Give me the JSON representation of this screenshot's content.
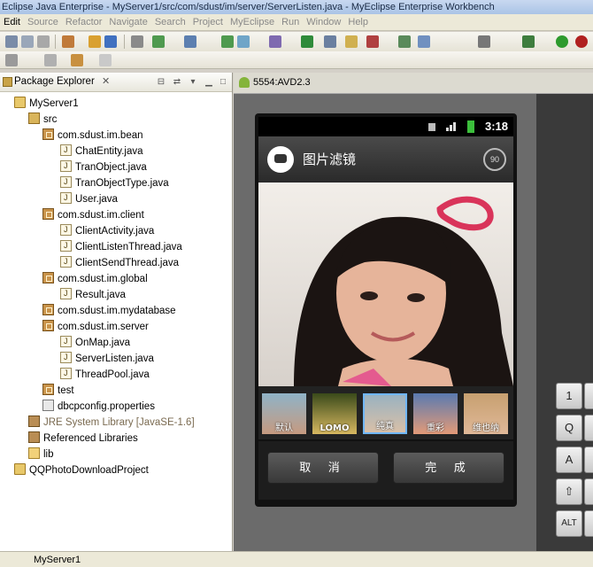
{
  "window": {
    "title": "Eclipse Java Enterprise - MyServer1/src/com/sdust/im/server/ServerListen.java - MyEclipse Enterprise Workbench"
  },
  "menu": [
    "Edit",
    "Source",
    "Refactor",
    "Navigate",
    "Search",
    "Project",
    "MyEclipse",
    "Run",
    "Window",
    "Help"
  ],
  "explorer": {
    "title": "Package Explorer",
    "tree": [
      {
        "label": "MyServer1",
        "icon": "project-icon",
        "indent": 0
      },
      {
        "label": "src",
        "icon": "source-folder-icon",
        "indent": 1
      },
      {
        "label": "com.sdust.im.bean",
        "icon": "package-icon",
        "indent": 2
      },
      {
        "label": "ChatEntity.java",
        "icon": "java-file-icon",
        "indent": 3
      },
      {
        "label": "TranObject.java",
        "icon": "java-file-icon",
        "indent": 3
      },
      {
        "label": "TranObjectType.java",
        "icon": "java-file-icon",
        "indent": 3
      },
      {
        "label": "User.java",
        "icon": "java-file-icon",
        "indent": 3
      },
      {
        "label": "com.sdust.im.client",
        "icon": "package-icon",
        "indent": 2
      },
      {
        "label": "ClientActivity.java",
        "icon": "java-file-icon",
        "indent": 3
      },
      {
        "label": "ClientListenThread.java",
        "icon": "java-file-icon",
        "indent": 3
      },
      {
        "label": "ClientSendThread.java",
        "icon": "java-file-icon",
        "indent": 3
      },
      {
        "label": "com.sdust.im.global",
        "icon": "package-icon",
        "indent": 2
      },
      {
        "label": "Result.java",
        "icon": "java-file-icon",
        "indent": 3
      },
      {
        "label": "com.sdust.im.mydatabase",
        "icon": "package-icon",
        "indent": 2
      },
      {
        "label": "com.sdust.im.server",
        "icon": "package-icon",
        "indent": 2
      },
      {
        "label": "OnMap.java",
        "icon": "java-file-icon",
        "indent": 3
      },
      {
        "label": "ServerListen.java",
        "icon": "java-file-icon",
        "indent": 3
      },
      {
        "label": "ThreadPool.java",
        "icon": "java-file-icon",
        "indent": 3
      },
      {
        "label": "test",
        "icon": "package-icon",
        "indent": 2
      },
      {
        "label": "dbcpconfig.properties",
        "icon": "properties-file-icon",
        "indent": 2
      },
      {
        "label": "JRE System Library [JavaSE-1.6]",
        "icon": "library-icon",
        "indent": 1
      },
      {
        "label": "Referenced Libraries",
        "icon": "library-icon",
        "indent": 1
      },
      {
        "label": "lib",
        "icon": "folder-icon",
        "indent": 1
      },
      {
        "label": "QQPhotoDownloadProject",
        "icon": "project-icon",
        "indent": 0
      }
    ]
  },
  "emulator": {
    "tab_title": "5554:AVD2.3",
    "status_time": "3:18",
    "app_title": "图片滤镜",
    "rotate_label": "90",
    "filters": [
      "默认",
      "LOMO",
      "纯真",
      "重彩",
      "维也纳"
    ],
    "selected_filter": "纯真",
    "cancel_label": "取 消",
    "done_label": "完 成",
    "keyboard_keys": [
      "1",
      "Q",
      "A",
      "⇧",
      "ALT"
    ]
  },
  "statusbar": {
    "text": "MyServer1"
  }
}
